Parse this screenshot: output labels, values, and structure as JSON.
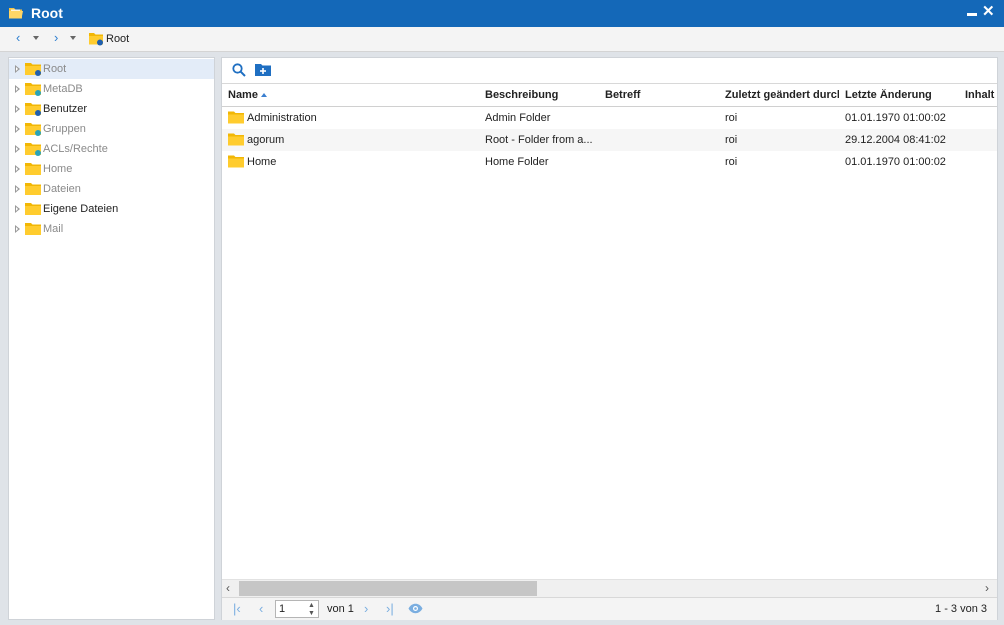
{
  "window": {
    "title": "Root",
    "minimize_icon": "minimize-icon",
    "close_icon": "close-icon",
    "accent": "#1468b8"
  },
  "nav": {
    "back_icon": "chevron-left-icon",
    "forward_icon": "chevron-right-icon",
    "breadcrumb": "Root"
  },
  "tree": {
    "items": [
      {
        "label": "Root",
        "badge": "blue",
        "selected": true
      },
      {
        "label": "MetaDB",
        "badge": "teal"
      },
      {
        "label": "Benutzer",
        "badge": "blue"
      },
      {
        "label": "Gruppen",
        "badge": "teal"
      },
      {
        "label": "ACLs/Rechte",
        "badge": "teal"
      },
      {
        "label": "Home"
      },
      {
        "label": "Dateien"
      },
      {
        "label": "Eigene Dateien"
      },
      {
        "label": "Mail"
      }
    ]
  },
  "toolbar": {
    "search_icon": "search-icon",
    "new_folder_icon": "new-folder-icon"
  },
  "grid": {
    "columns": [
      "Name",
      "Beschreibung",
      "Betreff",
      "Zuletzt geändert durch",
      "Letzte Änderung",
      "Inhalt"
    ],
    "rows": [
      {
        "name": "Administration",
        "description": "Admin Folder",
        "subject": "",
        "changed_by": "roi",
        "changed": "01.01.1970 01:00:02"
      },
      {
        "name": "agorum",
        "description": "Root - Folder from a...",
        "subject": "",
        "changed_by": "roi",
        "changed": "29.12.2004 08:41:02"
      },
      {
        "name": "Home",
        "description": "Home Folder",
        "subject": "",
        "changed_by": "roi",
        "changed": "01.01.1970 01:00:02"
      }
    ]
  },
  "pager": {
    "page": "1",
    "of_label": "von 1",
    "count_label": "1 - 3 von 3",
    "view_icon": "eye-icon"
  }
}
